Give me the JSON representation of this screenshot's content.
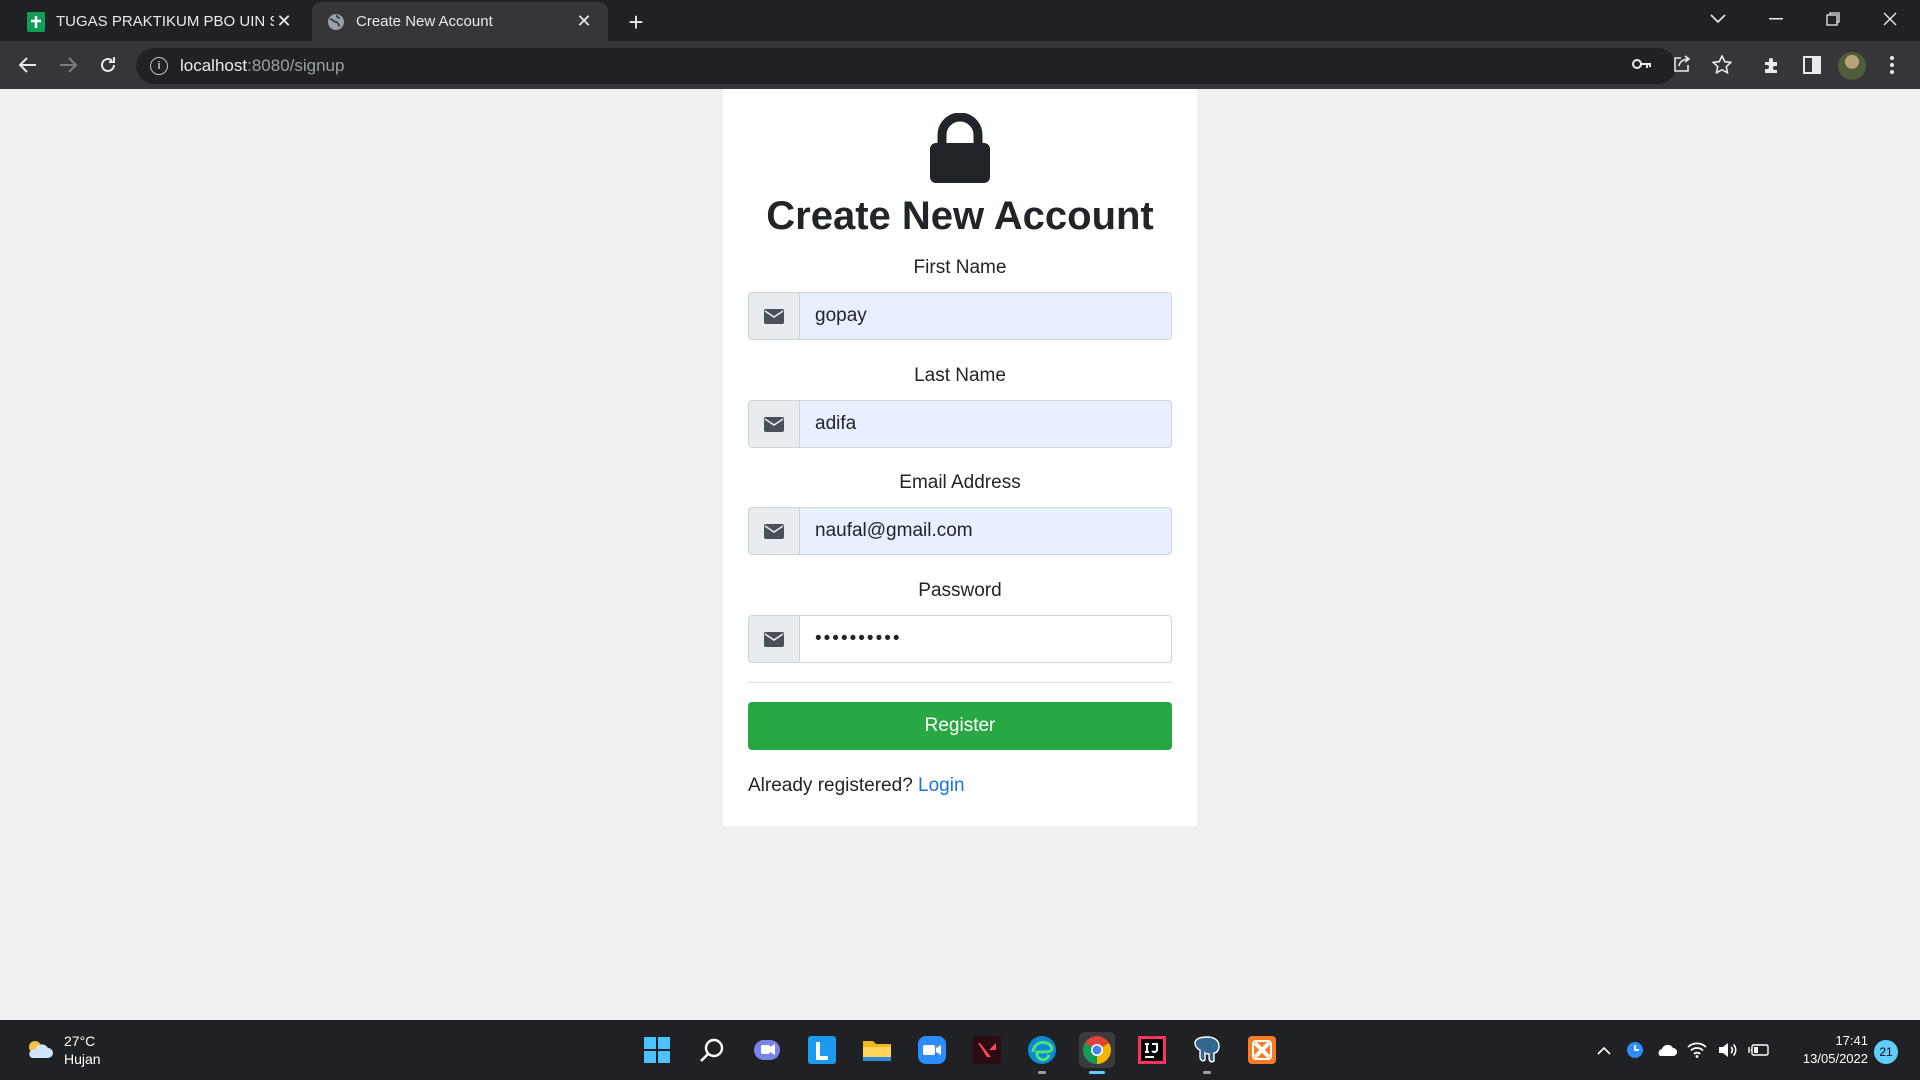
{
  "browser": {
    "tabs": [
      {
        "title": "TUGAS PRAKTIKUM PBO UIN SGD",
        "active": false
      },
      {
        "title": "Create New Account",
        "active": true
      }
    ],
    "url_host": "localhost",
    "url_rest": ":8080/signup"
  },
  "form": {
    "heading": "Create New Account",
    "first_name_label": "First Name",
    "first_name_value": "gopay",
    "last_name_label": "Last Name",
    "last_name_value": "adifa",
    "email_label": "Email Address",
    "email_value": "naufal@gmail.com",
    "password_label": "Password",
    "password_value": "••••••••••",
    "register_label": "Register",
    "already_text": "Already registered?",
    "login_label": "Login"
  },
  "taskbar": {
    "temperature": "27°C",
    "weather": "Hujan",
    "time": "17:41",
    "date": "13/05/2022",
    "notifications": "21"
  },
  "colors": {
    "register_green": "#28a745",
    "link_blue": "#1a73e8",
    "autofill_bg": "#e8f0fe"
  }
}
